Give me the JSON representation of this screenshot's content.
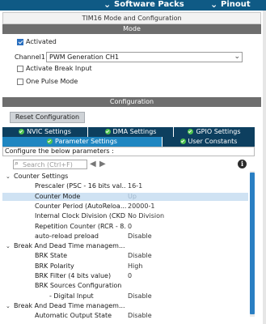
{
  "topbar": {
    "chevron": "⌄",
    "software_packs": "Software Packs",
    "pinout": "Pinout"
  },
  "title": "TIM16 Mode and Configuration",
  "mode": {
    "header": "Mode",
    "activated_label": "Activated",
    "activated_checked": true,
    "channel1_label": "Channel1",
    "channel1_value": "PWM Generation CH1",
    "activate_break_input_label": "Activate Break Input",
    "one_pulse_mode_label": "One Pulse Mode"
  },
  "configuration": {
    "header": "Configuration",
    "reset_button": "Reset Configuration",
    "tabs_row1": [
      "NVIC Settings",
      "DMA Settings",
      "GPIO Settings"
    ],
    "tabs_row2": [
      "Parameter Settings",
      "User Constants"
    ],
    "active_tab": "Parameter Settings",
    "configure_text": "Configure the below parameters :",
    "search_placeholder": "Search (Ctrl+F)",
    "info_glyph": "i"
  },
  "tree": [
    {
      "type": "group",
      "label": "Counter Settings"
    },
    {
      "type": "param",
      "label": "Prescaler (PSC - 16 bits val...",
      "value": "16-1"
    },
    {
      "type": "param",
      "label": "Counter Mode",
      "value": "Up",
      "selected": true
    },
    {
      "type": "param",
      "label": "Counter Period (AutoReloa...",
      "value": "20000-1"
    },
    {
      "type": "param",
      "label": "Internal Clock Division (CKD)",
      "value": "No Division"
    },
    {
      "type": "param",
      "label": "Repetition Counter (RCR - 8...",
      "value": "0"
    },
    {
      "type": "param",
      "label": "auto-reload preload",
      "value": "Disable"
    },
    {
      "type": "group",
      "label": "Break And Dead Time managem..."
    },
    {
      "type": "param",
      "label": "BRK State",
      "value": "Disable"
    },
    {
      "type": "param",
      "label": "BRK Polarity",
      "value": "High"
    },
    {
      "type": "param",
      "label": "BRK Filter (4 bits value)",
      "value": "0"
    },
    {
      "type": "param",
      "label": "BRK Sources Configuration",
      "value": ""
    },
    {
      "type": "param",
      "label": "- Digital Input",
      "value": "Disable",
      "indent": 2
    },
    {
      "type": "group",
      "label": "Break And Dead Time managem..."
    },
    {
      "type": "param",
      "label": "Automatic Output State",
      "value": "Disable"
    }
  ],
  "colors": {
    "accent": "#0f5a85",
    "tab_dark": "#0d3f5f",
    "tab_active": "#1f86c1",
    "section_header": "#6e6e6e"
  }
}
